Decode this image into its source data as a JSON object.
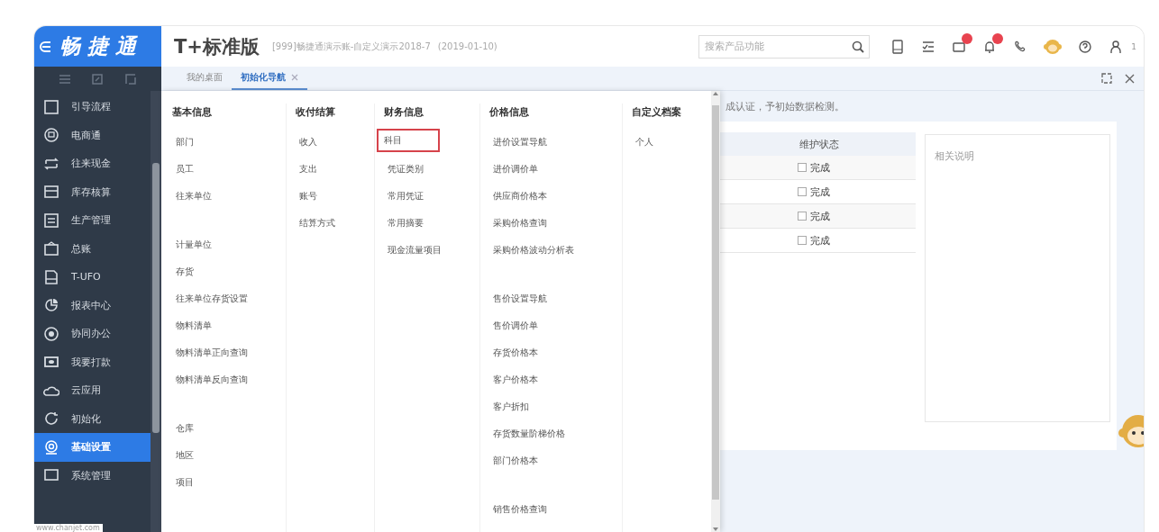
{
  "logo": {
    "text": "畅 捷 通"
  },
  "header": {
    "product": "T+标准版",
    "company": "[999]畅捷通演示账-自定义演示2018-7",
    "date": "(2019-01-10)",
    "search": {
      "placeholder": "搜索产品功能"
    },
    "user_label": "1"
  },
  "sidebar": {
    "items": [
      {
        "label": "引导流程",
        "selected": false
      },
      {
        "label": "电商通",
        "selected": false
      },
      {
        "label": "往来现金",
        "selected": false
      },
      {
        "label": "库存核算",
        "selected": false
      },
      {
        "label": "生产管理",
        "selected": false
      },
      {
        "label": "总账",
        "selected": false
      },
      {
        "label": "T-UFO",
        "selected": false
      },
      {
        "label": "报表中心",
        "selected": false
      },
      {
        "label": "协同办公",
        "selected": false
      },
      {
        "label": "我要打款",
        "selected": false
      },
      {
        "label": "云应用",
        "selected": false
      },
      {
        "label": "初始化",
        "selected": false
      },
      {
        "label": "基础设置",
        "selected": true
      },
      {
        "label": "系统管理",
        "selected": false
      }
    ]
  },
  "tabs": [
    {
      "label": "我的桌面",
      "selected": false,
      "closable": false
    },
    {
      "label": "初始化导航",
      "selected": true,
      "closable": true
    }
  ],
  "menu": {
    "columns": [
      {
        "title": "基本信息",
        "groups": [
          [
            {
              "label": "部门",
              "highlighted": false
            },
            {
              "label": "员工",
              "highlighted": false
            },
            {
              "label": "往来单位",
              "highlighted": false
            }
          ],
          [
            {
              "label": "计量单位",
              "highlighted": false
            },
            {
              "label": "存货",
              "highlighted": false
            },
            {
              "label": "往来单位存货设置",
              "highlighted": false
            },
            {
              "label": "物料清单",
              "highlighted": false
            },
            {
              "label": "物料清单正向查询",
              "highlighted": false
            },
            {
              "label": "物料清单反向查询",
              "highlighted": false
            }
          ],
          [
            {
              "label": "仓库",
              "highlighted": false
            },
            {
              "label": "地区",
              "highlighted": false
            },
            {
              "label": "项目",
              "highlighted": false
            }
          ]
        ]
      },
      {
        "title": "收付结算",
        "groups": [
          [
            {
              "label": "收入",
              "highlighted": false
            },
            {
              "label": "支出",
              "highlighted": false
            },
            {
              "label": "账号",
              "highlighted": false
            },
            {
              "label": "结算方式",
              "highlighted": false
            }
          ]
        ]
      },
      {
        "title": "财务信息",
        "groups": [
          [
            {
              "label": "科目",
              "highlighted": true
            },
            {
              "label": "凭证类别",
              "highlighted": false
            },
            {
              "label": "常用凭证",
              "highlighted": false
            },
            {
              "label": "常用摘要",
              "highlighted": false
            },
            {
              "label": "现金流量项目",
              "highlighted": false
            }
          ]
        ]
      },
      {
        "title": "价格信息",
        "groups": [
          [
            {
              "label": "进价设置导航",
              "highlighted": false
            },
            {
              "label": "进价调价单",
              "highlighted": false
            },
            {
              "label": "供应商价格本",
              "highlighted": false
            },
            {
              "label": "采购价格查询",
              "highlighted": false
            },
            {
              "label": "采购价格波动分析表",
              "highlighted": false
            }
          ],
          [
            {
              "label": "售价设置导航",
              "highlighted": false
            },
            {
              "label": "售价调价单",
              "highlighted": false
            },
            {
              "label": "存货价格本",
              "highlighted": false
            },
            {
              "label": "客户价格本",
              "highlighted": false
            },
            {
              "label": "客户折扣",
              "highlighted": false
            },
            {
              "label": "存货数量阶梯价格",
              "highlighted": false
            },
            {
              "label": "部门价格本",
              "highlighted": false
            }
          ],
          [
            {
              "label": "销售价格查询",
              "highlighted": false
            }
          ]
        ]
      },
      {
        "title": "自定义档案",
        "groups": [
          [
            {
              "label": "个人",
              "highlighted": false
            }
          ]
        ]
      }
    ]
  },
  "content": {
    "notice": "成认证，予初始数据检测。",
    "table": {
      "columns": [
        "维护状态"
      ],
      "rows": [
        {
          "status": "完成",
          "checked": false
        },
        {
          "status": "完成",
          "checked": false
        },
        {
          "status": "完成",
          "checked": false
        },
        {
          "status": "完成",
          "checked": false
        }
      ]
    },
    "side_panel": {
      "title": "相关说明"
    }
  },
  "status_bar": {
    "text": "www.chanjet.com"
  }
}
